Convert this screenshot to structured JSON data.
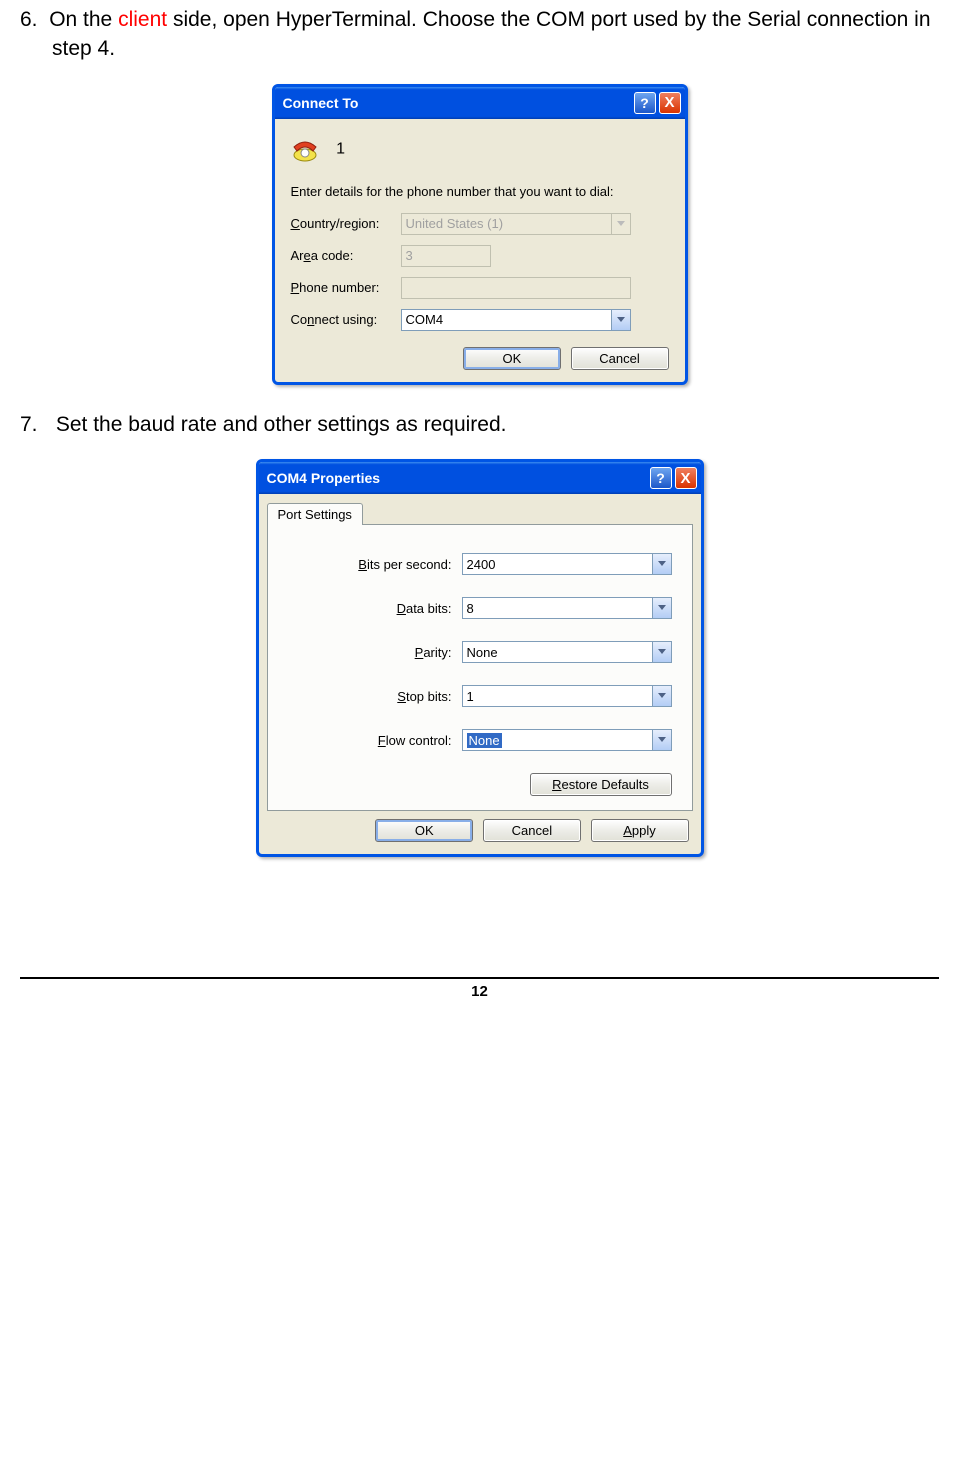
{
  "step6": {
    "num": "6.",
    "pre": "On the ",
    "red": "client",
    "post": " side, open HyperTerminal. Choose the COM port used by the Serial connection in step 4."
  },
  "step7": {
    "num": "7.",
    "text": "Set the baud rate and other settings as required."
  },
  "dialog1": {
    "title": "Connect To",
    "help": "?",
    "close": "X",
    "conn_name": "1",
    "prompt": "Enter details for the phone number that you want to dial:",
    "labels": {
      "country_c": "C",
      "country_rest": "ountry/region:",
      "area_pre": "Ar",
      "area_u": "e",
      "area_post": "a code:",
      "phone_u": "P",
      "phone_rest": "hone number:",
      "conn_pre": "Co",
      "conn_u": "n",
      "conn_post": "nect using:"
    },
    "values": {
      "country": "United States (1)",
      "area": "3",
      "phone": "",
      "connect": "COM4"
    },
    "buttons": {
      "ok": "OK",
      "cancel": "Cancel"
    }
  },
  "dialog2": {
    "title": "COM4 Properties",
    "help": "?",
    "close": "X",
    "tab": "Port Settings",
    "labels": {
      "bps_u": "B",
      "bps_rest": "its per second:",
      "data_u": "D",
      "data_rest": "ata bits:",
      "par_u": "P",
      "par_rest": "arity:",
      "stop_u": "S",
      "stop_rest": "top bits:",
      "flow_u": "F",
      "flow_rest": "low control:"
    },
    "values": {
      "bps": "2400",
      "data": "8",
      "parity": "None",
      "stop": "1",
      "flow": "None"
    },
    "restore_u": "R",
    "restore_rest": "estore Defaults",
    "buttons": {
      "ok": "OK",
      "cancel": "Cancel",
      "apply_u": "A",
      "apply_rest": "pply"
    }
  },
  "page_number": "12"
}
